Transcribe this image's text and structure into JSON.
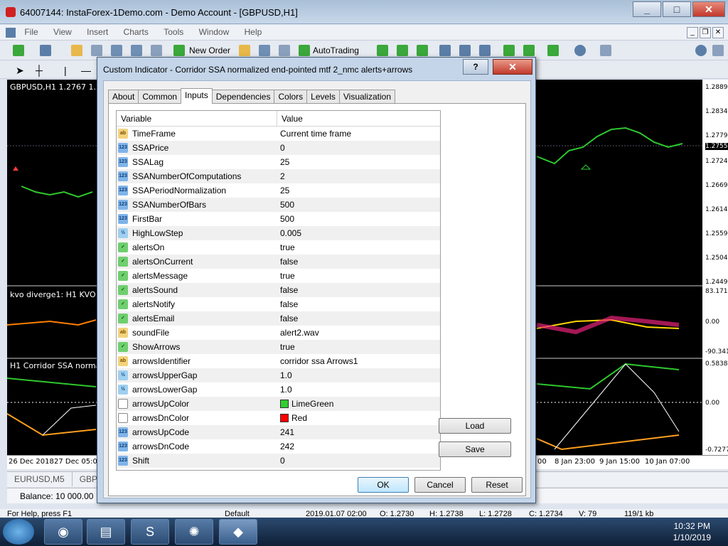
{
  "window": {
    "title": "64007144: InstaForex-1Demo.com - Demo Account - [GBPUSD,H1]"
  },
  "menu": [
    "File",
    "View",
    "Insert",
    "Charts",
    "Tools",
    "Window",
    "Help"
  ],
  "toolbar": {
    "new_order": "New Order",
    "autotrading": "AutoTrading"
  },
  "chart": {
    "main_label": "GBPUSD,H1  1.2767 1.27",
    "kvo_label": "kvo diverge1: H1  KVO (55,",
    "ssa_label": "H1 Corridor SSA normalized",
    "price_levels": [
      "1.2889",
      "1.2834",
      "1.2779",
      "1.2755",
      "1.2724",
      "1.2669",
      "1.2614",
      "1.2559",
      "1.2504",
      "1.2449"
    ],
    "kvo_levels": [
      "83.1711",
      "0.00",
      "-90.341"
    ],
    "ssa_levels": [
      "0.5838",
      "0.00",
      "-0.7277"
    ],
    "time_labels_left": [
      "26 Dec 2018",
      "27 Dec 05:00"
    ],
    "time_labels_right": [
      "00",
      "8 Jan 23:00",
      "9 Jan 15:00",
      "10 Jan 07:00"
    ]
  },
  "symbol_tabs": [
    "EURUSD,M5",
    "GBP"
  ],
  "terminal": {
    "balance": "Balance: 10 000.00"
  },
  "statusbar": {
    "help": "For Help, press F1",
    "profile": "Default",
    "datetime": "2019.01.07 02:00",
    "open": "O: 1.2730",
    "high": "H: 1.2738",
    "low": "L: 1.2728",
    "close": "C: 1.2734",
    "volume": "V: 79",
    "traffic": "119/1 kb"
  },
  "dialog": {
    "title": "Custom Indicator - Corridor SSA normalized end-pointed mtf 2_nmc alerts+arrows",
    "help_label": "?",
    "close_label": "✕",
    "tabs": [
      "About",
      "Common",
      "Inputs",
      "Dependencies",
      "Colors",
      "Levels",
      "Visualization"
    ],
    "active_tab": "Inputs",
    "grid_header": {
      "variable": "Variable",
      "value": "Value"
    },
    "rows": [
      {
        "icon": "ab",
        "variable": "TimeFrame",
        "value": "Current time frame"
      },
      {
        "icon": "123",
        "variable": "SSAPrice",
        "value": "0"
      },
      {
        "icon": "123",
        "variable": "SSALag",
        "value": "25"
      },
      {
        "icon": "123",
        "variable": "SSANumberOfComputations",
        "value": "2"
      },
      {
        "icon": "123",
        "variable": "SSAPeriodNormalization",
        "value": "25"
      },
      {
        "icon": "123",
        "variable": "SSANumberOfBars",
        "value": "500"
      },
      {
        "icon": "123",
        "variable": "FirstBar",
        "value": "500"
      },
      {
        "icon": "v2",
        "variable": "HighLowStep",
        "value": "0.005"
      },
      {
        "icon": "bool",
        "variable": "alertsOn",
        "value": "true"
      },
      {
        "icon": "bool",
        "variable": "alertsOnCurrent",
        "value": "false"
      },
      {
        "icon": "bool",
        "variable": "alertsMessage",
        "value": "true"
      },
      {
        "icon": "bool",
        "variable": "alertsSound",
        "value": "false"
      },
      {
        "icon": "bool",
        "variable": "alertsNotify",
        "value": "false"
      },
      {
        "icon": "bool",
        "variable": "alertsEmail",
        "value": "false"
      },
      {
        "icon": "ab",
        "variable": "soundFile",
        "value": "alert2.wav"
      },
      {
        "icon": "bool",
        "variable": "ShowArrows",
        "value": "true"
      },
      {
        "icon": "ab",
        "variable": "arrowsIdentifier",
        "value": "corridor ssa Arrows1"
      },
      {
        "icon": "v2",
        "variable": "arrowsUpperGap",
        "value": "1.0"
      },
      {
        "icon": "v2",
        "variable": "arrowsLowerGap",
        "value": "1.0"
      },
      {
        "icon": "color",
        "variable": "arrowsUpColor",
        "value": "LimeGreen",
        "swatch": "#32cd32"
      },
      {
        "icon": "color",
        "variable": "arrowsDnColor",
        "value": "Red",
        "swatch": "#ff0000"
      },
      {
        "icon": "123",
        "variable": "arrowsUpCode",
        "value": "241"
      },
      {
        "icon": "123",
        "variable": "arrowsDnCode",
        "value": "242"
      },
      {
        "icon": "123",
        "variable": "Shift",
        "value": "0"
      }
    ],
    "icon_text": {
      "ab": "ab",
      "123": "123",
      "v2": "½",
      "bool": "✓",
      "color": ""
    },
    "buttons": {
      "load": "Load",
      "save": "Save",
      "ok": "OK",
      "cancel": "Cancel",
      "reset": "Reset"
    }
  },
  "taskbar": {
    "time": "10:32 PM",
    "date": "1/10/2019"
  }
}
